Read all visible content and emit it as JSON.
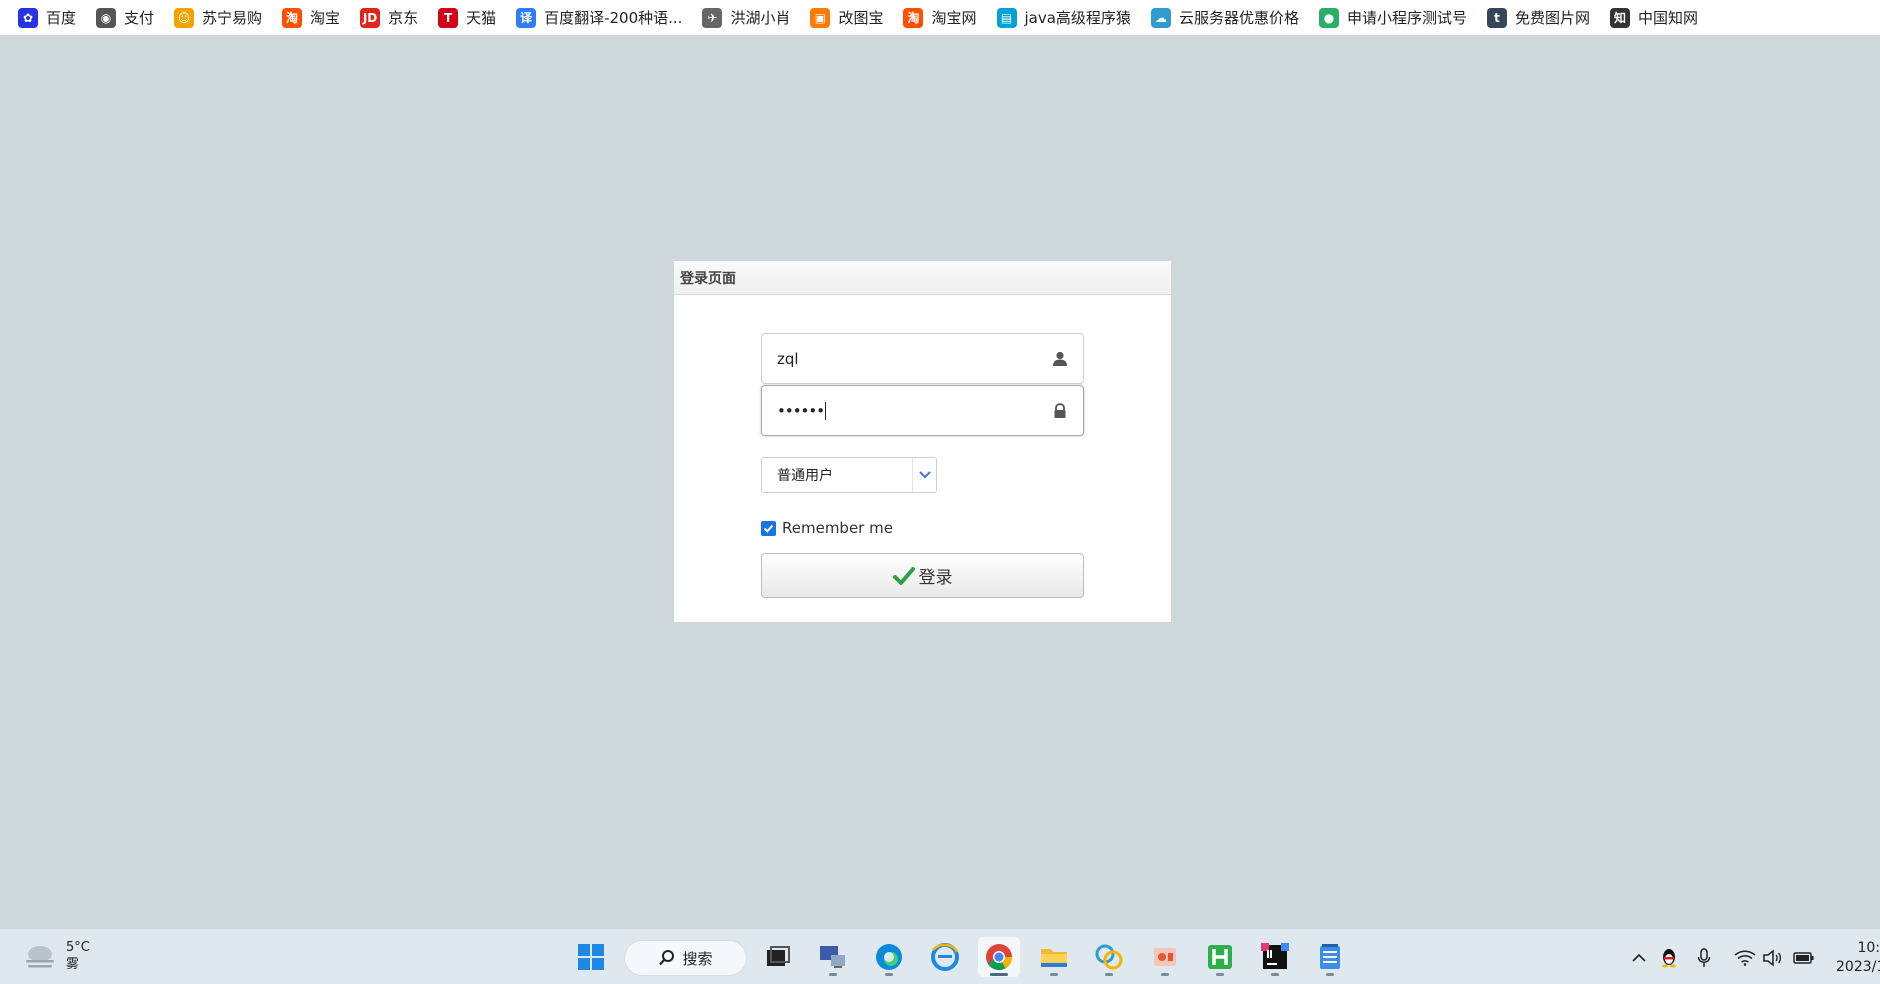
{
  "bookmarks": [
    {
      "label": "百度",
      "icon": "baidu-paw-icon",
      "color": "#2932e1"
    },
    {
      "label": "支付",
      "icon": "globe-icon",
      "color": "#555555"
    },
    {
      "label": "苏宁易购",
      "icon": "suning-lion-icon",
      "color": "#f5a300"
    },
    {
      "label": "淘宝",
      "icon": "taobao-icon",
      "color": "#ff5000"
    },
    {
      "label": "京东",
      "icon": "jd-icon",
      "color": "#e1251b"
    },
    {
      "label": "天猫",
      "icon": "tmall-icon",
      "color": "#d0021b"
    },
    {
      "label": "百度翻译-200种语...",
      "icon": "translate-icon",
      "color": "#2f7cf6"
    },
    {
      "label": "洪湖小肖",
      "icon": "bird-icon",
      "color": "#666666"
    },
    {
      "label": "改图宝",
      "icon": "gaitubao-icon",
      "color": "#ff7a00"
    },
    {
      "label": "淘宝网",
      "icon": "taobao-icon",
      "color": "#ff5000"
    },
    {
      "label": "java高级程序猿",
      "icon": "bilibili-icon",
      "color": "#00a1d6"
    },
    {
      "label": "云服务器优惠价格",
      "icon": "cloud-icon",
      "color": "#2f9cd0"
    },
    {
      "label": "申请小程序测试号",
      "icon": "wechat-icon",
      "color": "#2aae67"
    },
    {
      "label": "免费图片网",
      "icon": "tumblr-icon",
      "color": "#35465c"
    },
    {
      "label": "中国知网",
      "icon": "cnki-icon",
      "color": "#333333"
    }
  ],
  "panel": {
    "title": "登录页面",
    "username_value": "zql",
    "password_value": "••••••",
    "role_selected": "普通用户",
    "remember_label": "Remember me",
    "remember_checked": true,
    "login_label": "登录"
  },
  "taskbar": {
    "weather_temp": "5°C",
    "weather_desc": "雾",
    "search_label": "搜索",
    "clock_time": "10:",
    "clock_date": "2023/1"
  },
  "colors": {
    "page_bg": "#ced8db",
    "accent_check": "#2ea043",
    "checkbox_blue": "#1a73e8"
  }
}
